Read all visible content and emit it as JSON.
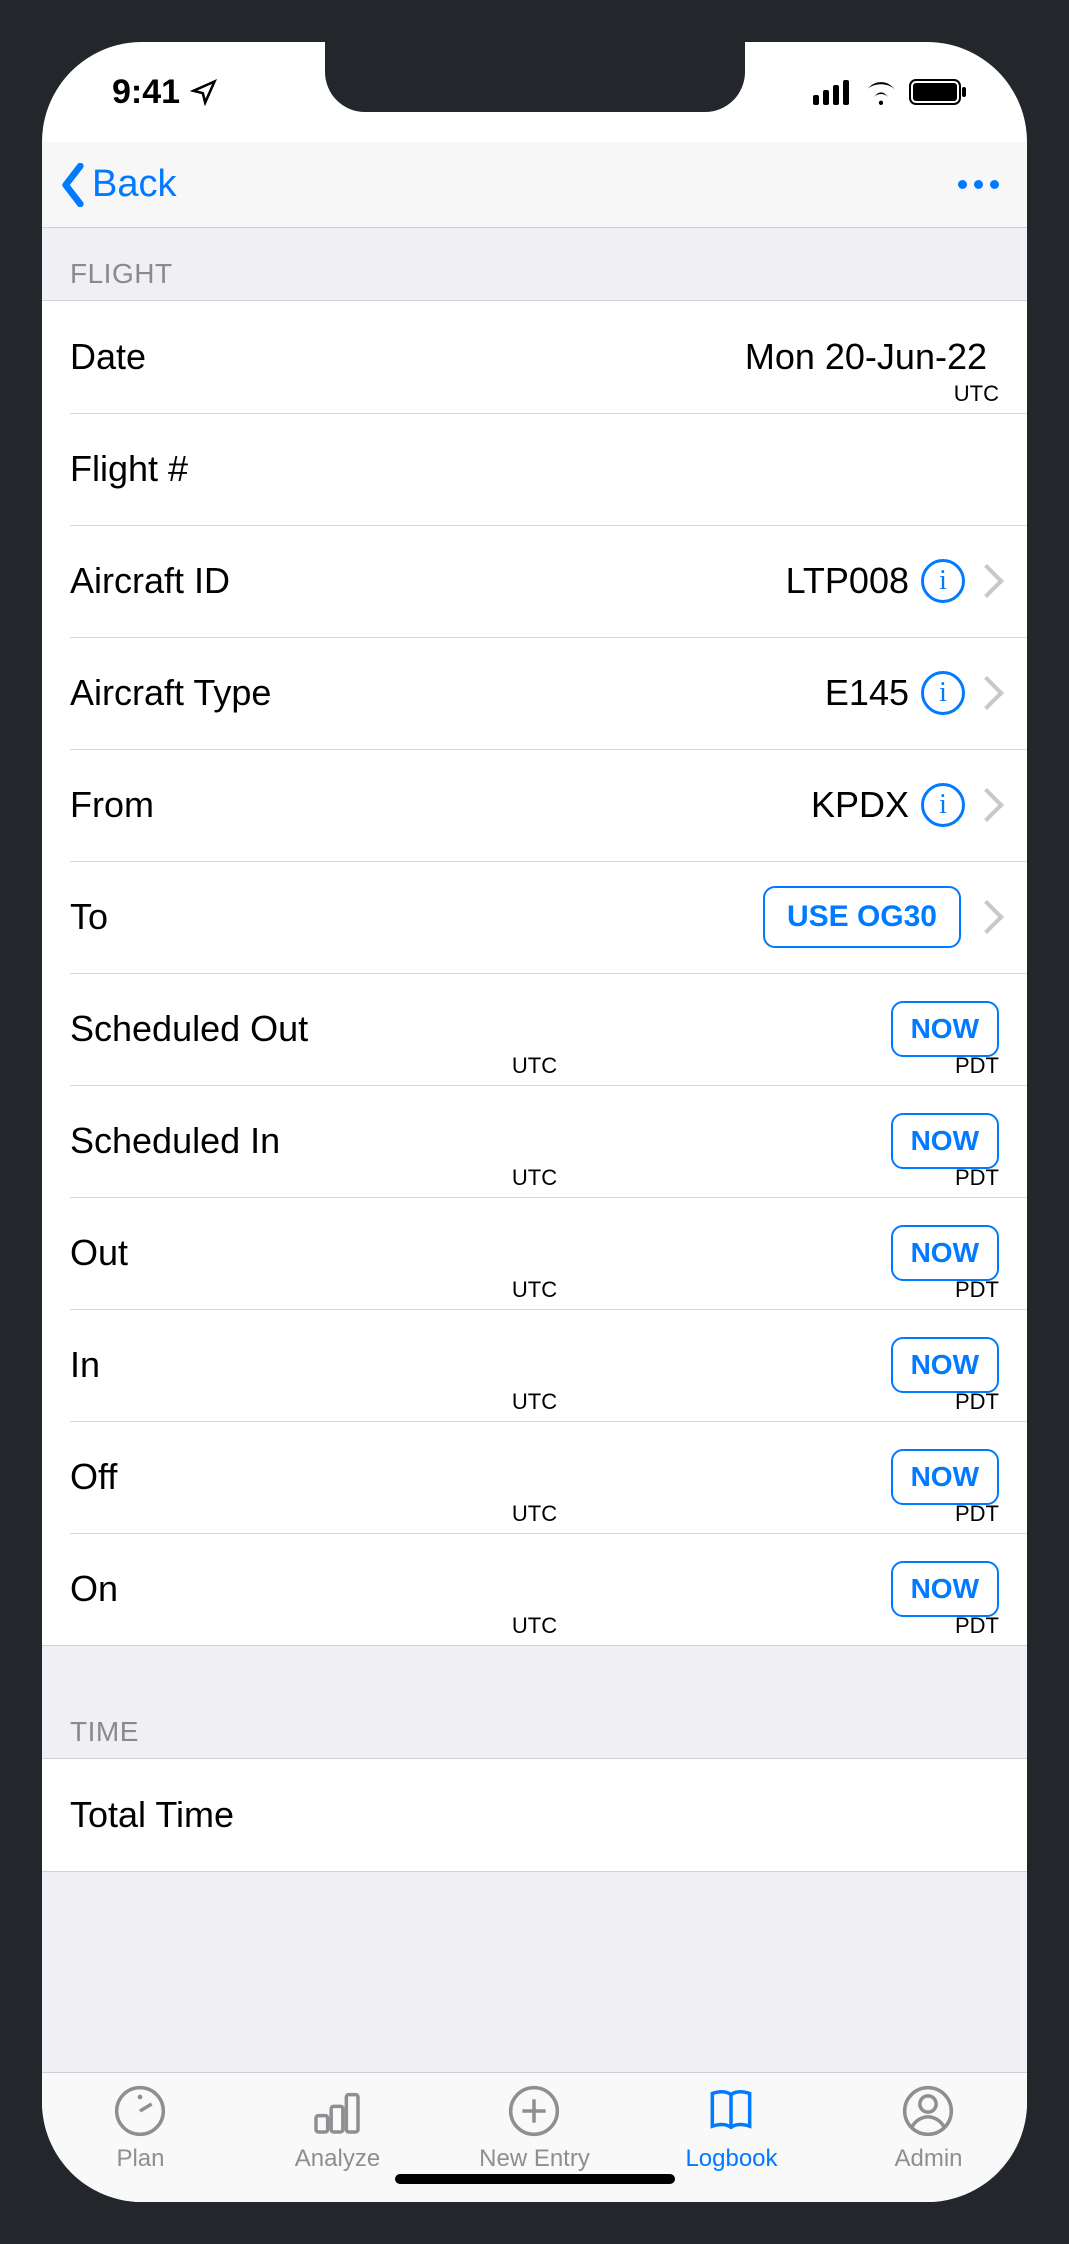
{
  "status": {
    "time": "9:41"
  },
  "nav": {
    "back_label": "Back"
  },
  "sections": {
    "flight_header": "Flight",
    "time_header": "Time"
  },
  "flight": {
    "date": {
      "label": "Date",
      "value": "Mon 20-Jun-22",
      "sub": "UTC"
    },
    "flight_no": {
      "label": "Flight #"
    },
    "aircraft_id": {
      "label": "Aircraft ID",
      "value": "LTP008"
    },
    "aircraft_type": {
      "label": "Aircraft Type",
      "value": "E145"
    },
    "from": {
      "label": "From",
      "value": "KPDX"
    },
    "to": {
      "label": "To",
      "button": "USE OG30"
    },
    "sched_out": {
      "label": "Scheduled Out",
      "button": "NOW",
      "mid": "UTC",
      "right": "PDT"
    },
    "sched_in": {
      "label": "Scheduled In",
      "button": "NOW",
      "mid": "UTC",
      "right": "PDT"
    },
    "out": {
      "label": "Out",
      "button": "NOW",
      "mid": "UTC",
      "right": "PDT"
    },
    "in": {
      "label": "In",
      "button": "NOW",
      "mid": "UTC",
      "right": "PDT"
    },
    "off": {
      "label": "Off",
      "button": "NOW",
      "mid": "UTC",
      "right": "PDT"
    },
    "on": {
      "label": "On",
      "button": "NOW",
      "mid": "UTC",
      "right": "PDT"
    }
  },
  "time": {
    "total": {
      "label": "Total Time"
    }
  },
  "tabs": {
    "plan": "Plan",
    "analyze": "Analyze",
    "new_entry": "New Entry",
    "logbook": "Logbook",
    "admin": "Admin"
  }
}
